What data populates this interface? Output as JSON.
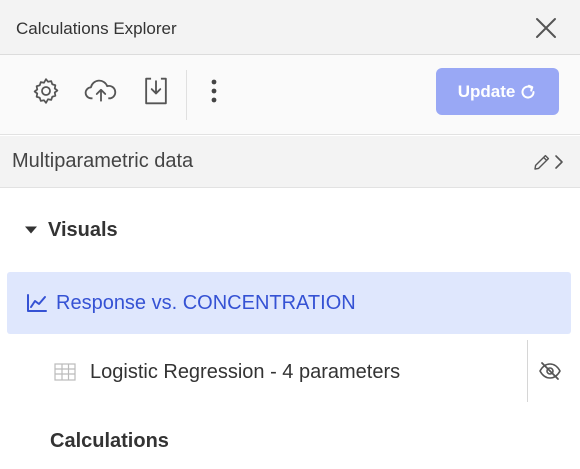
{
  "panel": {
    "title": "Calculations Explorer"
  },
  "toolbar": {
    "icons": [
      "gear-icon",
      "cloud-upload-icon",
      "import-icon",
      "more-vertical-icon"
    ],
    "update_label": "Update",
    "update_color": "#99a8f5"
  },
  "data_source": {
    "label": "Multiparametric data"
  },
  "visuals": {
    "section_title": "Visuals",
    "items": [
      {
        "label": "Response vs. CONCENTRATION",
        "icon": "line-chart-icon",
        "selected": true,
        "calculations": [
          {
            "label": "Logistic Regression - 4 parameters",
            "icon": "table-icon",
            "visibility_icon": "eye-off-icon"
          }
        ]
      }
    ]
  },
  "calculations": {
    "section_title": "Calculations"
  },
  "colors": {
    "accent": "#3552d4",
    "selected_bg": "#dfe7fd"
  }
}
